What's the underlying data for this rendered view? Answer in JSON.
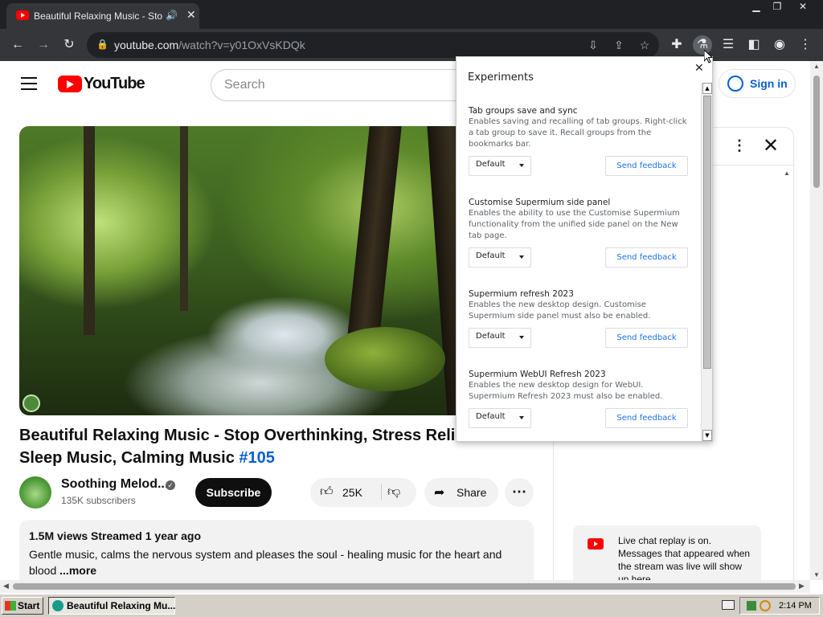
{
  "browser": {
    "tab_title": "Beautiful Relaxing Music - Stop",
    "url_host": "youtube.com",
    "url_path": "/watch?v=y01OxVsKDQk",
    "window_controls": [
      "minimize-icon",
      "restore-icon",
      "close-icon"
    ]
  },
  "youtube": {
    "logo_text": "YouTube",
    "search_placeholder": "Search",
    "signin_label": "Sign in",
    "video_title": "Beautiful Relaxing Music - Stop Overthinking, Stress Relief M",
    "video_title_line2": "Sleep Music, Calming Music ",
    "video_hashtag": "#105",
    "channel_name": "Soothing Melod...",
    "channel_subs": "135K subscribers",
    "subscribe_label": "Subscribe",
    "likes": "25K",
    "share_label": "Share",
    "desc_meta": "1.5M views  Streamed 1 year ago",
    "desc_text": "Gentle music, calms the nervous system and pleases the soul - healing music for the heart and blood ",
    "desc_more": "...more",
    "chat_replay_text": "Live chat replay is on. Messages that appeared when the stream was live will show up here."
  },
  "experiments": {
    "heading": "Experiments",
    "flags": [
      {
        "title": "Tab groups save and sync",
        "description": "Enables saving and recalling of tab groups. Right-click a tab group to save it. Recall groups from the bookmarks bar.",
        "value": "Default",
        "feedback_label": "Send feedback"
      },
      {
        "title": "Customise Supermium side panel",
        "description": "Enables the ability to use the Customise Supermium functionality from the unified side panel on the New tab page.",
        "value": "Default",
        "feedback_label": "Send feedback"
      },
      {
        "title": "Supermium refresh 2023",
        "description": "Enables the new desktop design. Customise Supermium side panel must also be enabled.",
        "value": "Default",
        "feedback_label": "Send feedback"
      },
      {
        "title": "Supermium WebUI Refresh 2023",
        "description": "Enables the new desktop design for WebUI. Supermium Refresh 2023 must also be enabled.",
        "value": "Default",
        "feedback_label": "Send feedback"
      }
    ]
  },
  "taskbar": {
    "start_label": "Start",
    "task_label": "Beautiful Relaxing Mu...",
    "clock": "2:14 PM"
  },
  "colors": {
    "accent_blue": "#065fd4",
    "youtube_red": "#ff0000",
    "chrome_dark": "#202124"
  }
}
